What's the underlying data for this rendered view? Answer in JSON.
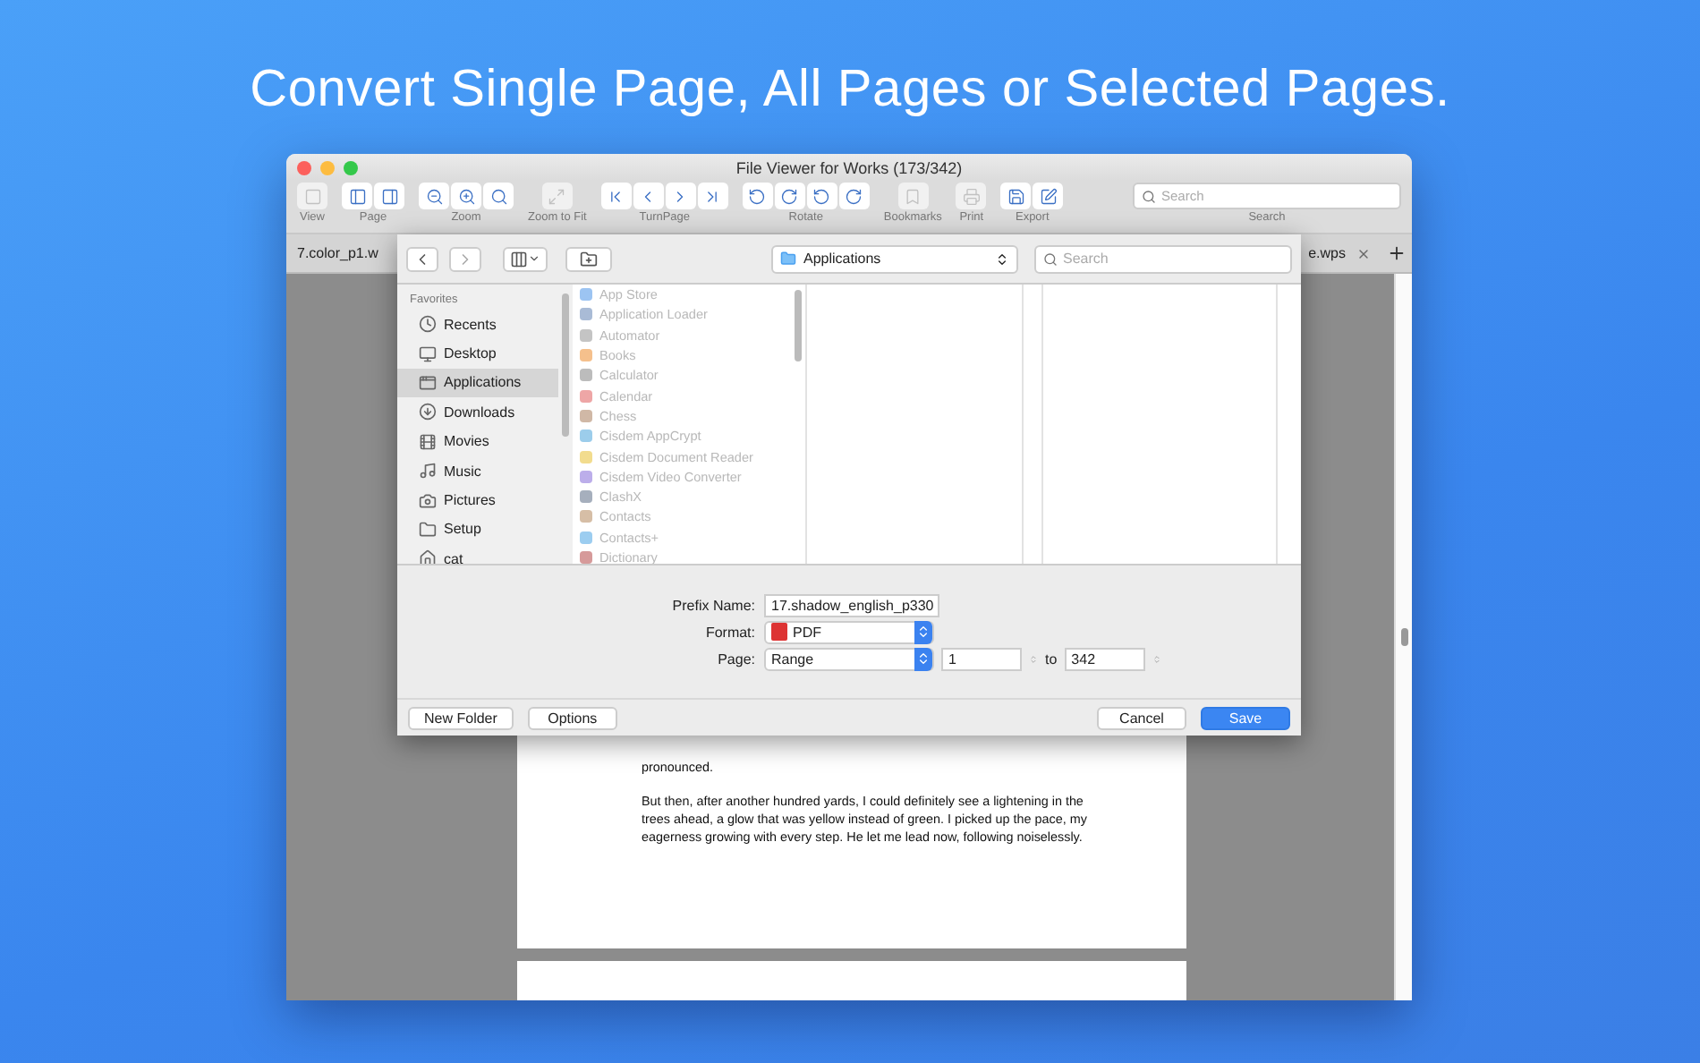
{
  "headline": "Convert Single Page, All Pages or Selected Pages.",
  "window": {
    "title": "File Viewer for Works (173/342)"
  },
  "toolbar": [
    {
      "kind": "buttons",
      "label": "View",
      "disabled": true
    },
    {
      "kind": "buttons",
      "label": "Page",
      "disabled": false
    },
    {
      "kind": "buttons",
      "label": "Zoom",
      "disabled": false
    },
    {
      "kind": "buttons",
      "label": "Zoom to Fit",
      "disabled": true
    },
    {
      "kind": "buttons",
      "label": "TurnPage",
      "disabled": false
    },
    {
      "kind": "buttons",
      "label": "Rotate",
      "disabled": false
    },
    {
      "kind": "buttons",
      "label": "Bookmarks",
      "disabled": true
    },
    {
      "kind": "buttons",
      "label": "Print",
      "disabled": true
    },
    {
      "kind": "buttons",
      "label": "Export",
      "disabled": false
    },
    {
      "kind": "search",
      "label": "Search",
      "placeholder": "Search"
    }
  ],
  "tabs": [
    {
      "label": "7.color_p1.w",
      "selected": false
    },
    {
      "label": "e.wps",
      "selected": false
    }
  ],
  "document": {
    "paragraphs": [
      "pronounced.",
      "But then, after another hundred yards, I could definitely see a lightening in the trees ahead, a glow that was yellow instead of green. I picked up the pace, my eagerness growing with every step. He let me lead now, following noiselessly."
    ]
  },
  "dialog": {
    "location": "Applications",
    "search_placeholder": "Search",
    "sidebar_heading": "Favorites",
    "sidebar": [
      {
        "label": "Recents",
        "selected": false
      },
      {
        "label": "Desktop",
        "selected": false
      },
      {
        "label": "Applications",
        "selected": true
      },
      {
        "label": "Downloads",
        "selected": false
      },
      {
        "label": "Movies",
        "selected": false
      },
      {
        "label": "Music",
        "selected": false
      },
      {
        "label": "Pictures",
        "selected": false
      },
      {
        "label": "Setup",
        "selected": false
      },
      {
        "label": "cat",
        "selected": false
      }
    ],
    "apps": [
      {
        "name": "App Store",
        "color": "#9cc4f2",
        "disabled": true
      },
      {
        "name": "Application Loader",
        "color": "#a9bbd6",
        "disabled": true
      },
      {
        "name": "Automator",
        "color": "#c4c4c4",
        "disabled": true
      },
      {
        "name": "Books",
        "color": "#f5c08c",
        "disabled": true
      },
      {
        "name": "Calculator",
        "color": "#bcbcbc",
        "disabled": true
      },
      {
        "name": "Calendar",
        "color": "#eea6a6",
        "disabled": true
      },
      {
        "name": "Chess",
        "color": "#d0b8a6",
        "disabled": true
      },
      {
        "name": "Cisdem AppCrypt",
        "color": "#9ccdeb",
        "disabled": true
      },
      {
        "name": "Cisdem Document Reader",
        "color": "#f2dc8e",
        "disabled": true
      },
      {
        "name": "Cisdem Video Converter",
        "color": "#bcaeea",
        "disabled": true
      },
      {
        "name": "ClashX",
        "color": "#a6afbd",
        "disabled": true
      },
      {
        "name": "Contacts",
        "color": "#d6bea6",
        "disabled": true
      },
      {
        "name": "Contacts+",
        "color": "#9ccdf0",
        "disabled": true
      },
      {
        "name": "Dictionary",
        "color": "#d69a9a",
        "disabled": true
      }
    ],
    "form": {
      "prefix_label": "Prefix Name:",
      "prefix_value": "17.shadow_english_p330",
      "format_label": "Format:",
      "format_value": "PDF",
      "page_label": "Page:",
      "page_value": "Range",
      "from": "1",
      "to_label": "to",
      "to": "342"
    },
    "left_buttons": [
      {
        "label": "New Folder",
        "default": false
      },
      {
        "label": "Options",
        "default": false
      }
    ],
    "right_buttons": [
      {
        "label": "Cancel",
        "default": false
      },
      {
        "label": "Save",
        "default": true
      }
    ]
  }
}
